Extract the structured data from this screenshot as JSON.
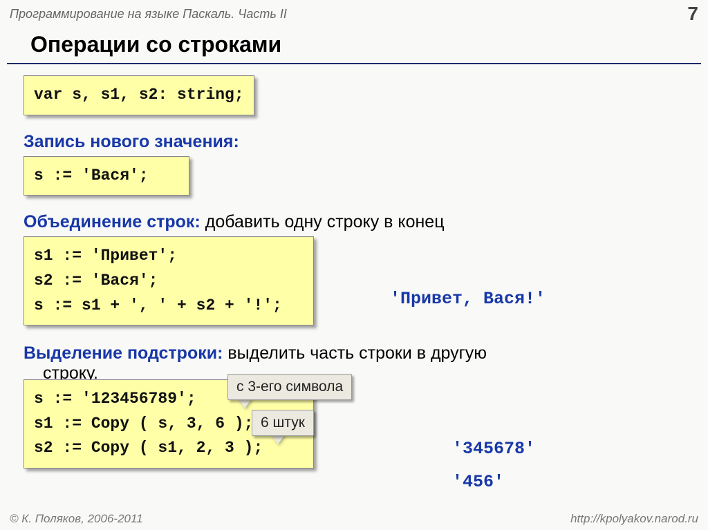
{
  "header": {
    "course_title": "Программирование на языке Паскаль. Часть II",
    "page_number": "7"
  },
  "title": "Операции со строками",
  "code_declaration": "var s, s1, s2: string;",
  "section1": {
    "label": "Запись нового значения:",
    "code": "s := 'Вася';"
  },
  "section2": {
    "label": "Объединение строк:",
    "desc": " добавить одну строку в конец",
    "code_lines": [
      "s1 := 'Привет';",
      "s2 := 'Вася';",
      "s := s1 + ', ' + s2 + '!';"
    ],
    "result": "'Привет, Вася!'"
  },
  "section3": {
    "label": "Выделение подстроки:",
    "desc": " выделить часть строки в другую",
    "desc_cont": "строку.",
    "code_lines": [
      "s := '123456789';",
      "",
      "s1 := Copy ( s, 3, 6 );",
      "s2 := Copy ( s1, 2, 3 );"
    ],
    "callout1": "с 3-его символа",
    "callout2": "6 штук",
    "result1": "'345678'",
    "result2": "'456'"
  },
  "footer": {
    "copyright": "© К. Поляков, 2006-2011",
    "url": "http://kpolyakov.narod.ru"
  }
}
